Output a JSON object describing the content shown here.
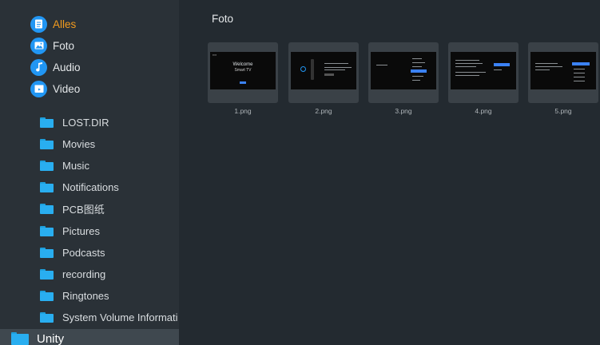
{
  "sidebar": {
    "categories": [
      {
        "label": "Alles",
        "icon": "document-icon",
        "color": "#2196f3",
        "active": true
      },
      {
        "label": "Foto",
        "icon": "photo-icon",
        "color": "#2196f3",
        "active": false
      },
      {
        "label": "Audio",
        "icon": "music-note-icon",
        "color": "#2196f3",
        "active": false
      },
      {
        "label": "Video",
        "icon": "video-icon",
        "color": "#2196f3",
        "active": false
      }
    ],
    "folders": [
      {
        "label": "LOST.DIR"
      },
      {
        "label": "Movies"
      },
      {
        "label": "Music"
      },
      {
        "label": "Notifications"
      },
      {
        "label": "PCB图纸"
      },
      {
        "label": "Pictures"
      },
      {
        "label": "Podcasts"
      },
      {
        "label": "recording"
      },
      {
        "label": "Ringtones"
      },
      {
        "label": "System Volume Informati"
      },
      {
        "label": "Unity",
        "selected": true
      }
    ]
  },
  "main": {
    "title": "Foto",
    "files": [
      {
        "name": "1.png",
        "preview": {
          "title": "Welcome",
          "subtitle": "Smart TV"
        }
      },
      {
        "name": "2.png"
      },
      {
        "name": "3.png"
      },
      {
        "name": "4.png"
      },
      {
        "name": "5.png"
      }
    ]
  },
  "colors": {
    "accent": "#f29b1e",
    "folder": "#29aef0",
    "background": "#232a30",
    "sidebar": "#2a3137",
    "selection": "#3f484f"
  }
}
